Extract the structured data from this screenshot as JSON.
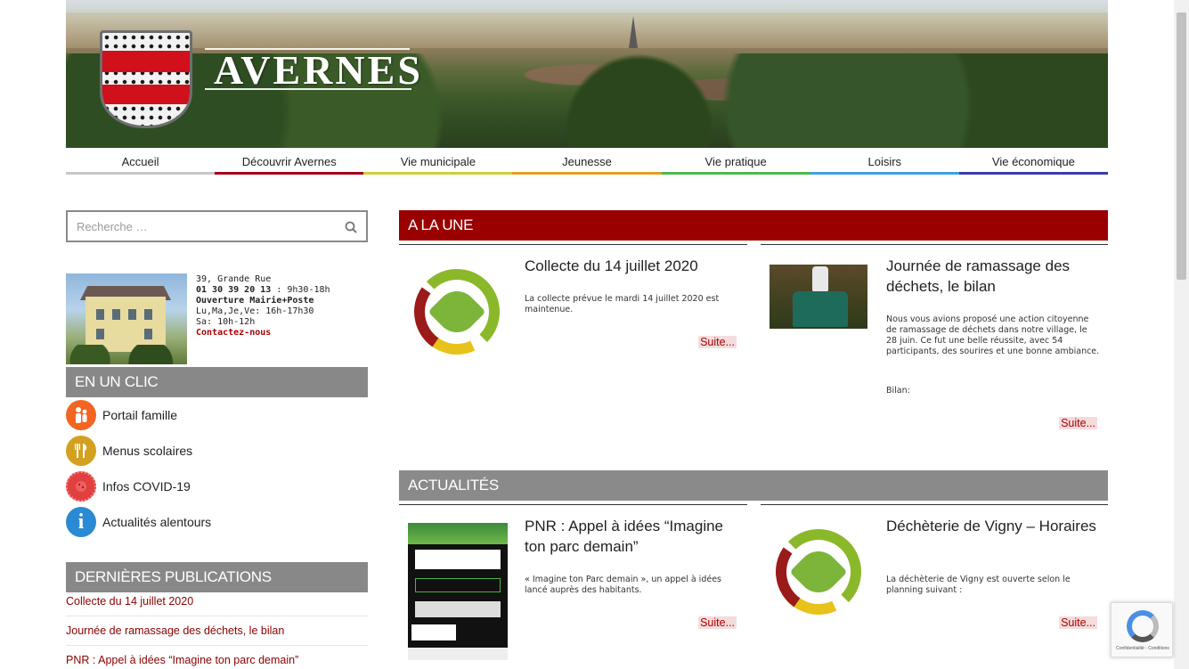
{
  "header": {
    "site_title": "AVERNES"
  },
  "nav": {
    "items": [
      {
        "label": "Accueil",
        "color": "#c8c8c8"
      },
      {
        "label": "Découvrir Avernes",
        "color": "#a0001a"
      },
      {
        "label": "Vie municipale",
        "color": "#cfcf3a"
      },
      {
        "label": "Jeunesse",
        "color": "#e0a020"
      },
      {
        "label": "Vie pratique",
        "color": "#4db84d"
      },
      {
        "label": "Loisirs",
        "color": "#3da0e0"
      },
      {
        "label": "Vie économique",
        "color": "#3a3ab0"
      }
    ]
  },
  "search": {
    "placeholder": "Recherche …",
    "icon": "search-icon"
  },
  "mairie": {
    "address": "39, Grande Rue",
    "phone": "01 30 39 20 13",
    "phone_hours": " : 9h30-18h",
    "opening_title": "Ouverture Mairie+Poste",
    "hours1": "Lu,Ma,Je,Ve: 16h-17h30",
    "hours2": "Sa: 10h-12h",
    "contact": "Contactez-nous"
  },
  "sidebar": {
    "en_un_clic": {
      "title": "EN UN CLIC",
      "links": [
        {
          "label": "Portail famille",
          "icon": "family-icon",
          "color": "#f26522"
        },
        {
          "label": "Menus scolaires",
          "icon": "cutlery-icon",
          "color": "#d4a020"
        },
        {
          "label": "Infos COVID-19",
          "icon": "virus-icon",
          "color": "#e04040"
        },
        {
          "label": "Actualités alentours",
          "icon": "info-icon",
          "color": "#2a8ad4"
        }
      ]
    },
    "publications": {
      "title": "DERNIÈRES PUBLICATIONS",
      "items": [
        "Collecte du 14 juillet 2020",
        "Journée de ramassage des déchets, le bilan",
        "PNR : Appel à idées “Imagine ton parc demain”"
      ]
    }
  },
  "main": {
    "a_la_une": {
      "title": "A LA UNE",
      "cards": [
        {
          "title": "Collecte du 14 juillet 2020",
          "excerpt": "La collecte prévue le mardi 14 juillet 2020 est maintenue.",
          "more": "Suite..."
        },
        {
          "title": "Journée de ramassage des déchets, le bilan",
          "excerpt": "Nous vous avions proposé une action citoyenne de ramassage de déchets dans notre village, le 28 juin. Ce fut une belle réussite, avec 54 participants, des sourires et une bonne ambiance.",
          "excerpt2": "Bilan:",
          "more": "Suite..."
        }
      ]
    },
    "actualites": {
      "title": "ACTUALITÉS",
      "cards": [
        {
          "title": "PNR : Appel à idées “Imagine ton parc demain”",
          "excerpt": "« Imagine ton Parc demain », un appel à idées lancé auprès des habitants.",
          "more": "Suite..."
        },
        {
          "title": "Déchèterie de Vigny – Horaires",
          "excerpt": "La déchèterie de Vigny est ouverte selon le planning suivant  :",
          "more": "Suite..."
        }
      ]
    }
  },
  "recaptcha": {
    "text": "Confidentialité - Conditions"
  }
}
